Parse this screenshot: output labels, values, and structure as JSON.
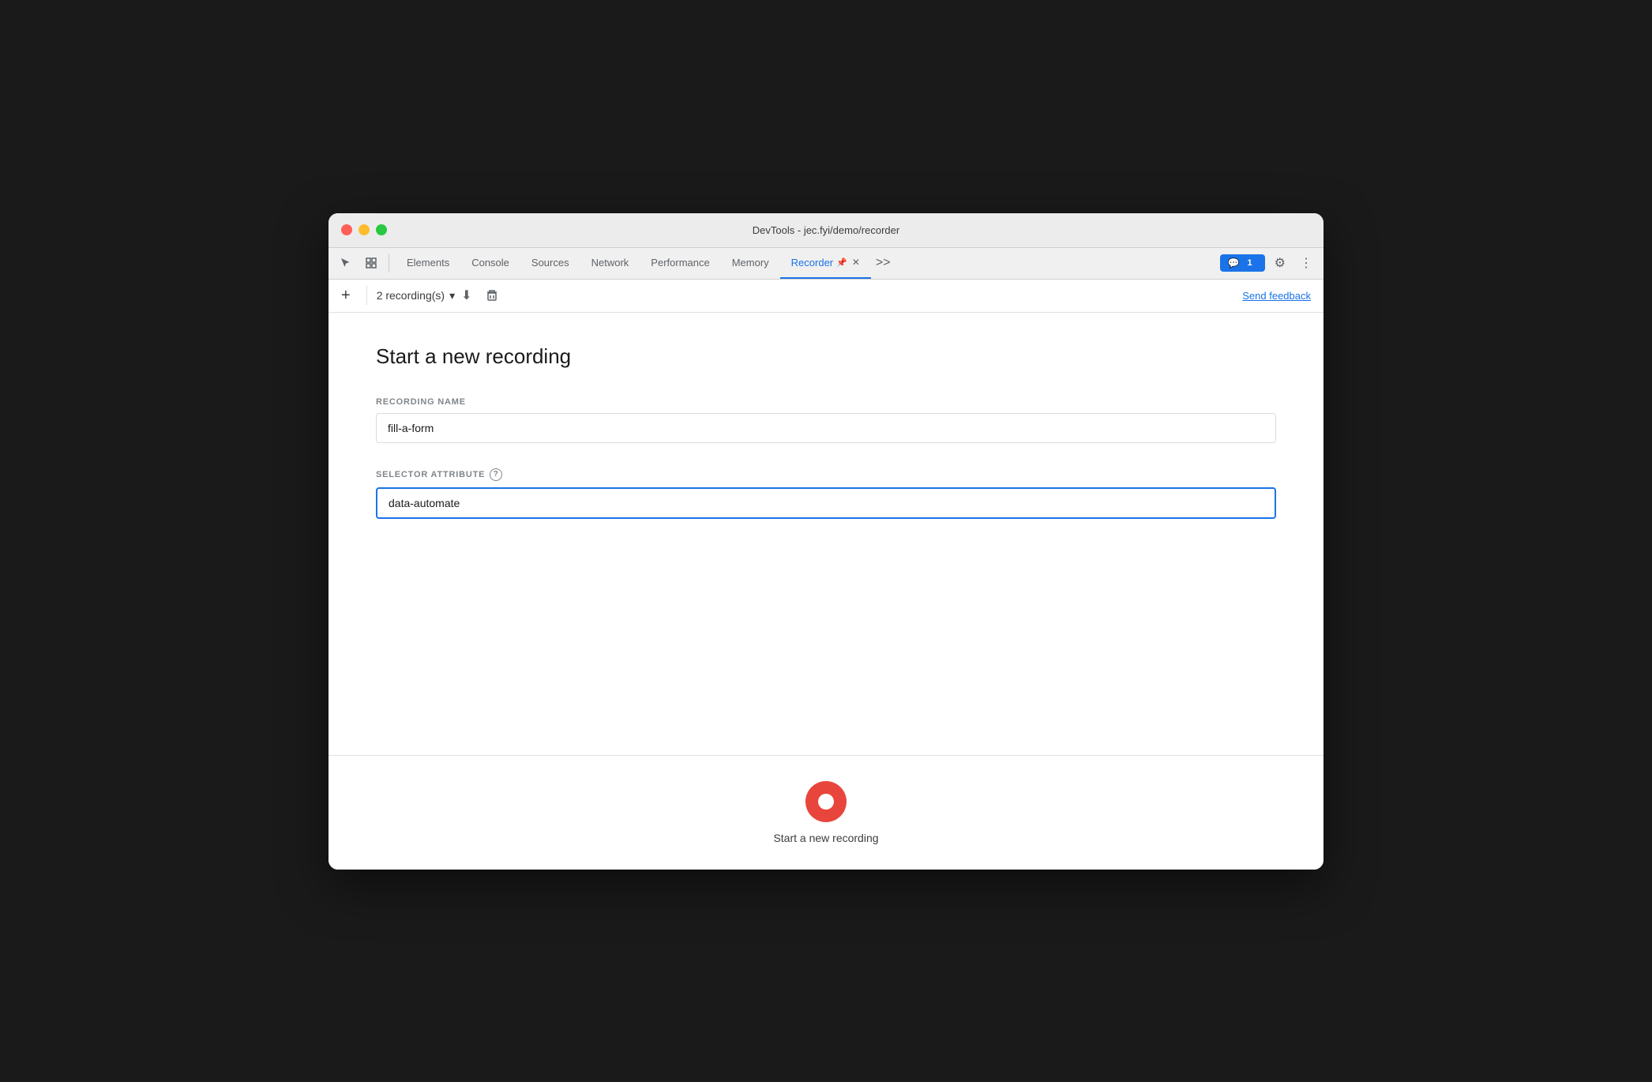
{
  "window": {
    "title": "DevTools - jec.fyi/demo/recorder"
  },
  "titlebar": {
    "buttons": {
      "close": "close",
      "minimize": "minimize",
      "maximize": "maximize"
    }
  },
  "toolbar": {
    "tabs": [
      {
        "id": "elements",
        "label": "Elements",
        "active": false
      },
      {
        "id": "console",
        "label": "Console",
        "active": false
      },
      {
        "id": "sources",
        "label": "Sources",
        "active": false
      },
      {
        "id": "network",
        "label": "Network",
        "active": false
      },
      {
        "id": "performance",
        "label": "Performance",
        "active": false
      },
      {
        "id": "memory",
        "label": "Memory",
        "active": false
      },
      {
        "id": "recorder",
        "label": "Recorder",
        "active": true
      }
    ],
    "more_tabs_label": ">>",
    "feedback_count": "1",
    "settings_icon": "⚙",
    "more_icon": "⋮"
  },
  "secondary_toolbar": {
    "add_label": "+",
    "recording_count": "2 recording(s)",
    "send_feedback_label": "Send feedback"
  },
  "main": {
    "page_title": "Start a new recording",
    "recording_name_label": "RECORDING NAME",
    "recording_name_value": "fill-a-form",
    "selector_attribute_label": "SELECTOR ATTRIBUTE",
    "selector_attribute_value": "data-automate",
    "help_icon_label": "?",
    "record_button_label": "Start a new recording"
  }
}
